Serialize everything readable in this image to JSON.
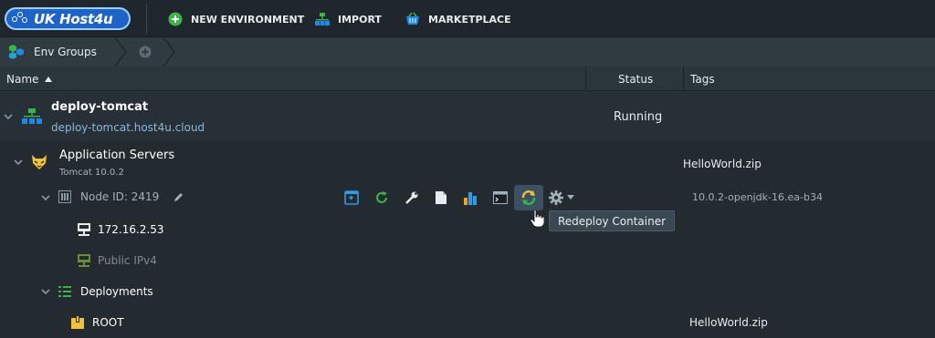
{
  "topbar": {
    "logo_text": "UK Host4u",
    "buttons": [
      {
        "label": "NEW ENVIRONMENT"
      },
      {
        "label": "IMPORT"
      },
      {
        "label": "MARKETPLACE"
      }
    ]
  },
  "breadcrumb": {
    "root_label": "Env Groups"
  },
  "table": {
    "columns": {
      "name": "Name",
      "status": "Status",
      "tags": "Tags"
    }
  },
  "environment": {
    "name": "deploy-tomcat",
    "domain": "deploy-tomcat.host4u.cloud",
    "status": "Running"
  },
  "app_servers": {
    "title": "Application Servers",
    "subtitle": "Tomcat 10.0.2",
    "tag": "HelloWorld.zip"
  },
  "node": {
    "label": "Node ID: 2419",
    "version_tag": "10.0.2-openjdk-16.ea-b34",
    "ip": "172.16.2.53",
    "public_ip": "Public IPv4"
  },
  "deployments": {
    "title": "Deployments",
    "root": "ROOT",
    "root_tag": "HelloWorld.zip"
  },
  "tooltip": {
    "text": "Redeploy Container"
  },
  "colors": {
    "background": "#232b31",
    "accent_green": "#3bb54a",
    "accent_blue": "#1d63c8",
    "status_running": "#e8ecef"
  }
}
